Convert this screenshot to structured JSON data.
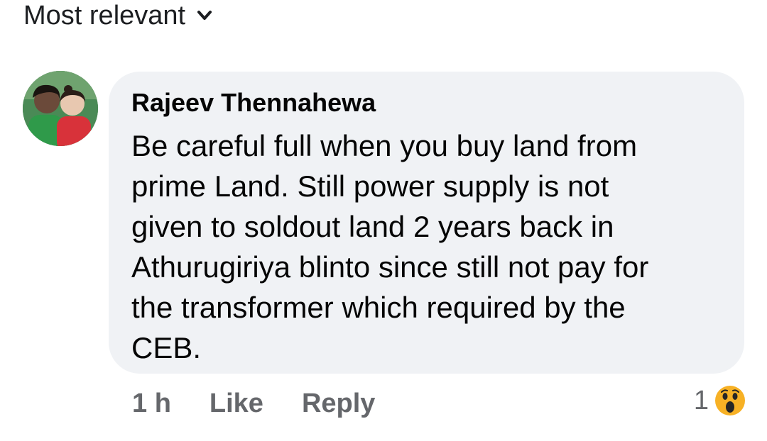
{
  "sort": {
    "label": "Most relevant",
    "icon": "chevron-down-icon"
  },
  "comment": {
    "author": "Rajeev Thennahewa",
    "avatar_icon": "profile-photo",
    "text": "Be careful full when you buy land from\nprime Land. Still power supply is not\ngiven to soldout land 2 years back in\nAthurugiriya blinto since still not pay for\nthe transformer which required by the\nCEB.",
    "time": "1 h",
    "like_label": "Like",
    "reply_label": "Reply",
    "reaction_count": "1",
    "reaction_icon": "wow-reaction-icon"
  },
  "colors": {
    "bubble_bg": "#f0f2f5",
    "secondary_text": "#65676b",
    "primary_text": "#050505",
    "wow_yellow": "#f7b125"
  }
}
